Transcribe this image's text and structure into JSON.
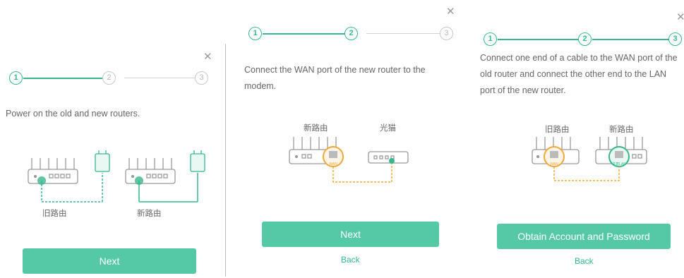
{
  "panel1": {
    "steps": [
      "1",
      "2",
      "3"
    ],
    "description": "Power on the old and new routers.",
    "old_router_label": "旧路由",
    "new_router_label": "新路由",
    "next_label": "Next"
  },
  "panel2": {
    "steps": [
      "1",
      "2",
      "3"
    ],
    "description": "Connect the WAN port of the new router to the modem.",
    "new_router_label": "新路由",
    "modem_label": "光猫",
    "port_label": "WAN",
    "next_label": "Next",
    "back_label": "Back"
  },
  "panel3": {
    "steps": [
      "1",
      "2",
      "3"
    ],
    "description": "Connect one end of a cable to the WAN port of the old router and connect the other end to the LAN port of the new router.",
    "old_router_label": "旧路由",
    "new_router_label": "新路由",
    "old_port_label": "WAN",
    "new_port_label": "任意LAN",
    "obtain_label": "Obtain Account and Password",
    "back_label": "Back"
  },
  "colors": {
    "accent": "#37b68f",
    "button": "#55c8a6",
    "highlight": "#f2a83b"
  }
}
